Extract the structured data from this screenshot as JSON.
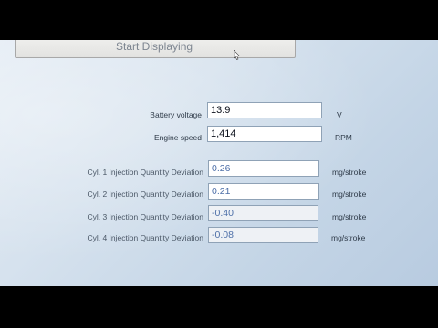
{
  "toolbar": {
    "start_label": "Start Displaying"
  },
  "measurements": {
    "battery": {
      "label": "Battery voltage",
      "value": "13.9",
      "unit": "V"
    },
    "engine": {
      "label": "Engine speed",
      "value": "1,414",
      "unit": "RPM"
    },
    "cyl1": {
      "label": "Cyl. 1 Injection Quantity Deviation",
      "value": "0.26",
      "unit": "mg/stroke"
    },
    "cyl2": {
      "label": "Cyl. 2 Injection Quantity Deviation",
      "value": "0.21",
      "unit": "mg/stroke"
    },
    "cyl3": {
      "label": "Cyl. 3 Injection Quantity Deviation",
      "value": "-0.40",
      "unit": "mg/stroke"
    },
    "cyl4": {
      "label": "Cyl. 4 Injection Quantity Deviation",
      "value": "-0.08",
      "unit": "mg/stroke"
    }
  },
  "colors": {
    "background": "#c8d8e8",
    "field_text": "#0a0f1a",
    "deviation_text": "#4d6fa8",
    "label_text": "#2e3a48"
  }
}
